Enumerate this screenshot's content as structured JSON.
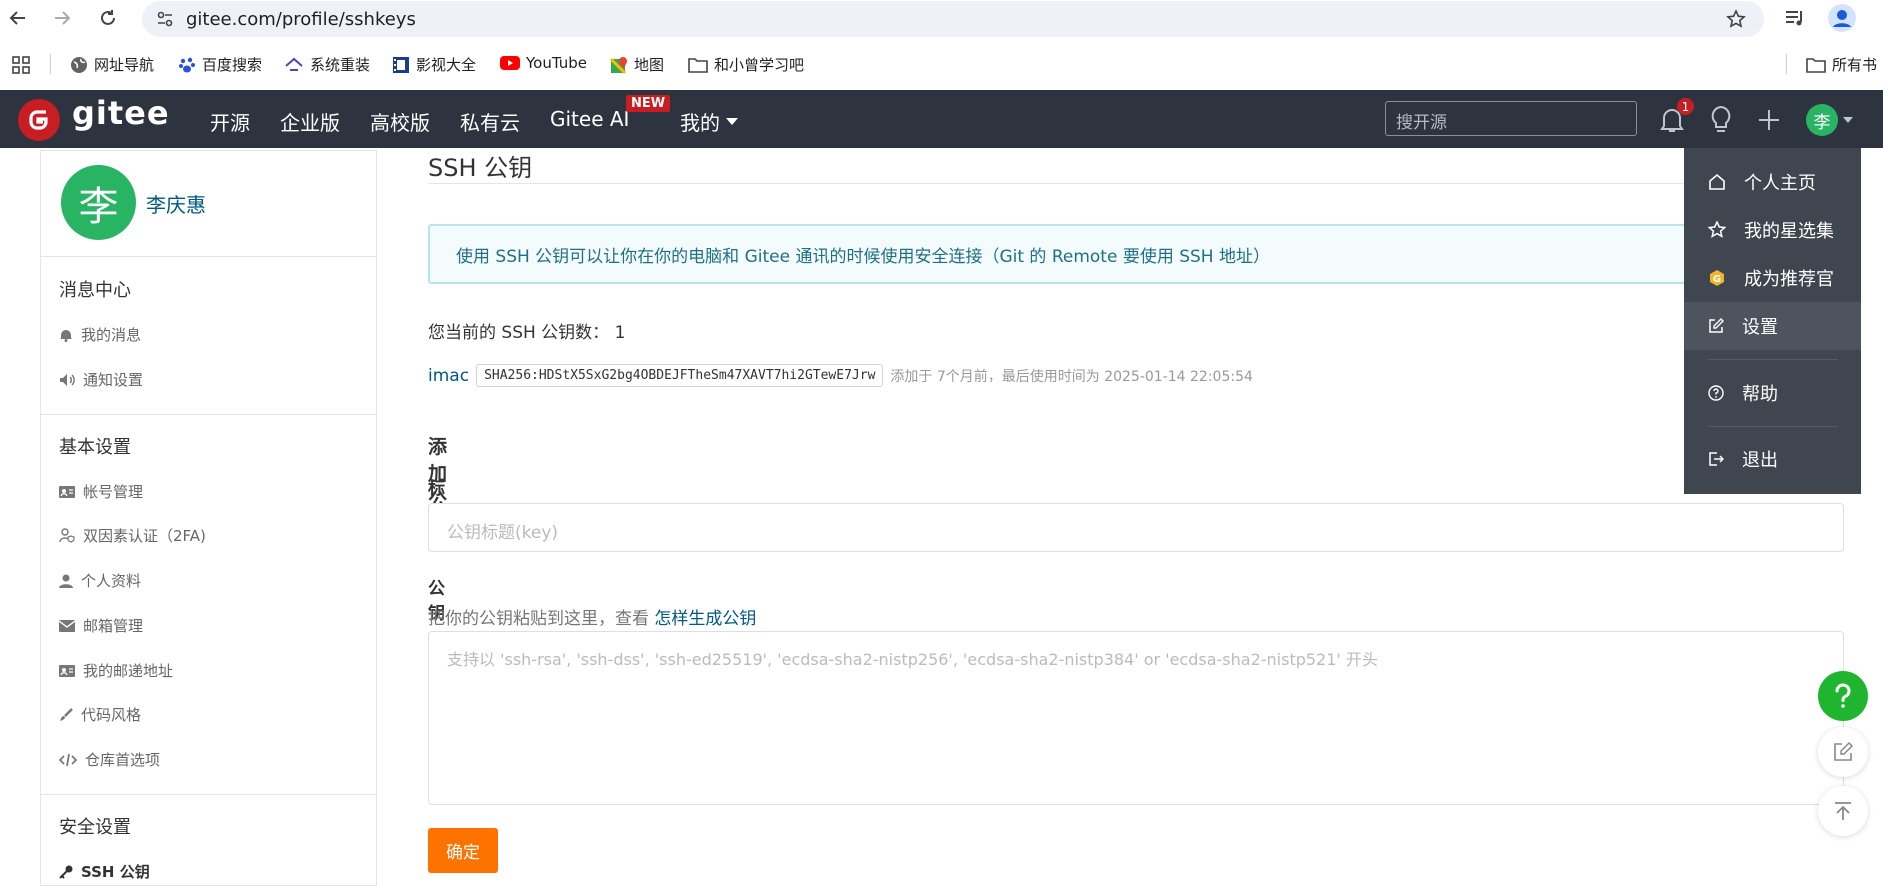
{
  "browser": {
    "url": "gitee.com/profile/sshkeys",
    "bookmarks": [
      {
        "label": "网址导航"
      },
      {
        "label": "百度搜索"
      },
      {
        "label": "系统重装"
      },
      {
        "label": "影视大全"
      },
      {
        "label": "YouTube"
      },
      {
        "label": "地图"
      },
      {
        "label": "和小曾学习吧"
      }
    ],
    "all_bookmarks": "所有书"
  },
  "header": {
    "logo": "gitee",
    "nav": [
      "开源",
      "企业版",
      "高校版",
      "私有云",
      "Gitee AI",
      "我的"
    ],
    "new_badge": "NEW",
    "search_placeholder": "搜开源",
    "notification_count": "1",
    "avatar_char": "李"
  },
  "sidebar": {
    "avatar_char": "李",
    "username": "李庆惠",
    "sections": [
      {
        "title": "消息中心",
        "items": [
          "我的消息",
          "通知设置"
        ]
      },
      {
        "title": "基本设置",
        "items": [
          "帐号管理",
          "双因素认证（2FA)",
          "个人资料",
          "邮箱管理",
          "我的邮递地址",
          "代码风格",
          "仓库首选项"
        ]
      },
      {
        "title": "安全设置",
        "items": [
          "SSH 公钥"
        ]
      }
    ]
  },
  "main": {
    "title": "SSH 公钥",
    "info": "使用 SSH 公钥可以让你在你的电脑和 Gitee 通讯的时候使用安全连接（Git 的 Remote 要使用 SSH 地址）",
    "key_count": "您当前的 SSH 公钥数：  1",
    "key": {
      "name": "imac",
      "fingerprint": "SHA256:HDStX5SxG2bg4OBDEJFTheSm47XAVT7hi2GTewE7Jrw",
      "meta": "添加于 7个月前，最后使用时间为 2025-01-14 22:05:54"
    },
    "add_heading": "添加公钥",
    "title_label": "标题",
    "title_placeholder": "公钥标题(key)",
    "key_label": "公钥",
    "hint_prefix": "把你的公钥粘贴到这里，查看",
    "hint_link": "怎样生成公钥",
    "key_placeholder": "支持以 'ssh-rsa', 'ssh-dss', 'ssh-ed25519', 'ecdsa-sha2-nistp256', 'ecdsa-sha2-nistp384' or 'ecdsa-sha2-nistp521' 开头",
    "submit": "确定"
  },
  "dropdown": {
    "items": [
      "个人主页",
      "我的星选集",
      "成为推荐官",
      "设置",
      "帮助",
      "退出"
    ]
  },
  "colors": {
    "header_bg": "#2d3440",
    "accent": "#fe7300",
    "brand": "#c71d23",
    "link": "#005980",
    "avatar": "#28b463",
    "help_fab": "#1fb52f"
  }
}
